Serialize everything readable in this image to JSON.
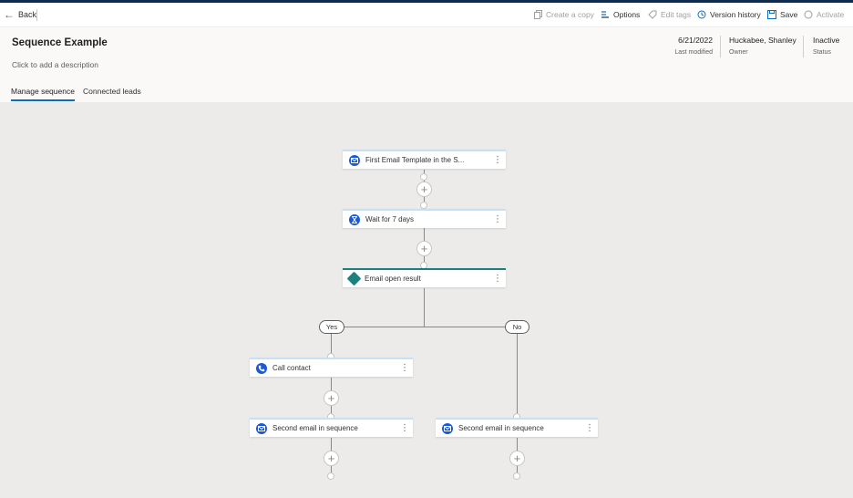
{
  "commandbar": {
    "back_label": "Back",
    "create_copy_label": "Create a copy",
    "options_label": "Options",
    "edit_tags_label": "Edit tags",
    "version_history_label": "Version history",
    "save_label": "Save",
    "activate_label": "Activate"
  },
  "header": {
    "title": "Sequence Example",
    "description": "Click to add a description",
    "last_modified_value": "6/21/2022",
    "last_modified_label": "Last modified",
    "owner_value": "Huckabee, Shanley",
    "owner_label": "Owner",
    "status_value": "Inactive",
    "status_label": "Status"
  },
  "tabs": [
    {
      "label": "Manage sequence",
      "active": true
    },
    {
      "label": "Connected leads",
      "active": false
    }
  ],
  "designer": {
    "steps": [
      {
        "label": "First Email Template in the S...",
        "icon": "email-icon"
      },
      {
        "label": "Wait for 7 days",
        "icon": "hourglass-icon"
      },
      {
        "label": "Email open result",
        "icon": "condition-icon"
      }
    ],
    "branches": {
      "yes_label": "Yes",
      "no_label": "No",
      "yes_steps": [
        {
          "label": "Call contact",
          "icon": "phone-icon"
        },
        {
          "label": "Second email in sequence",
          "icon": "email-icon"
        }
      ],
      "no_steps": [
        {
          "label": "Second email in sequence",
          "icon": "email-icon"
        }
      ]
    }
  },
  "colors": {
    "accent": "#0f6cbd",
    "node_icon": "#1a5ad6",
    "condition": "#1e7f7f",
    "canvas": "#ecebe9"
  }
}
